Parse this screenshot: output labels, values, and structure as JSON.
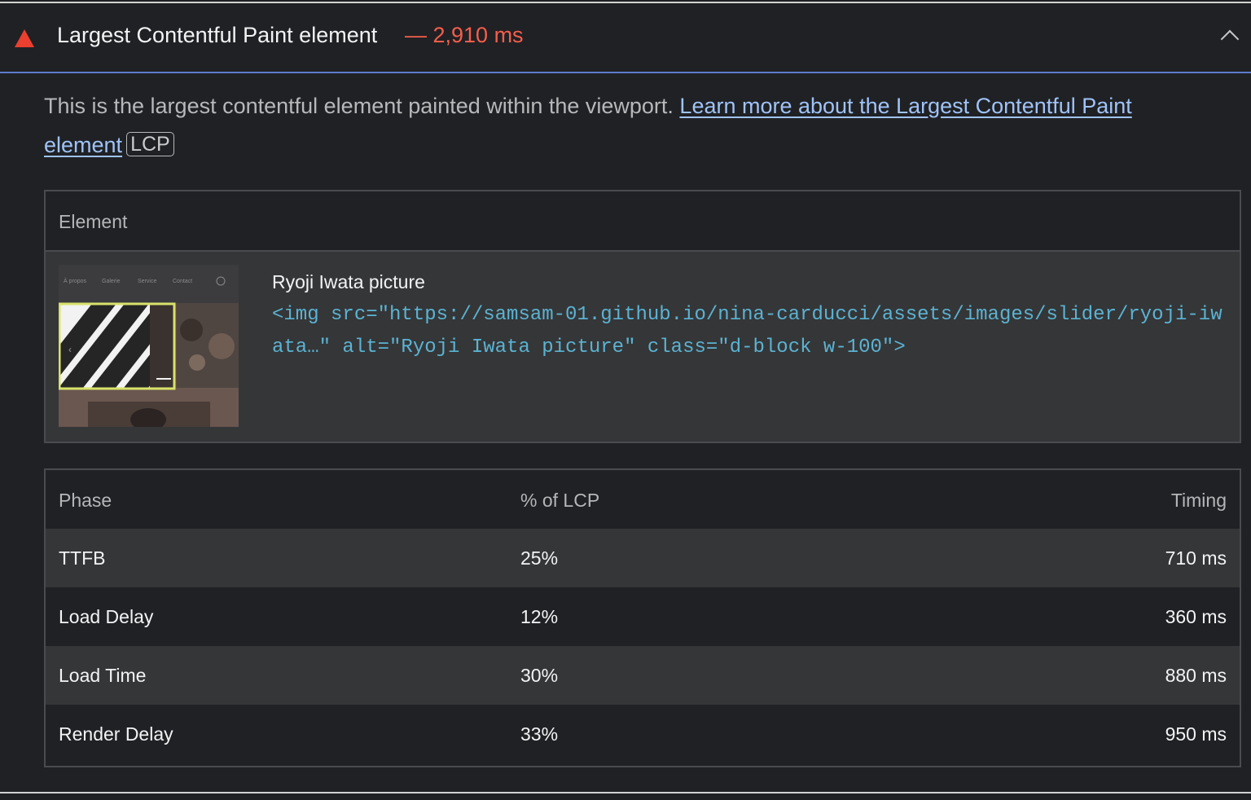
{
  "audit": {
    "title": "Largest Contentful Paint element",
    "value": "— 2,910 ms",
    "description_text": "This is the largest contentful element painted within the viewport. ",
    "learn_more_link": "Learn more about the Largest Contentful Paint element",
    "badge": "LCP"
  },
  "element_table": {
    "header": "Element",
    "node_label": "Ryoji Iwata picture",
    "node_snippet": "<img src=\"https://samsam-01.github.io/nina-carducci/assets/images/slider/ryoji-iwata…\" alt=\"Ryoji Iwata picture\" class=\"d-block w-100\">",
    "thumbnail_nav": [
      "À propos",
      "Galerie",
      "Service",
      "Contact"
    ]
  },
  "phase_table": {
    "headers": {
      "phase": "Phase",
      "percent": "% of LCP",
      "timing": "Timing"
    },
    "rows": [
      {
        "phase": "TTFB",
        "percent": "25%",
        "timing": "710 ms"
      },
      {
        "phase": "Load Delay",
        "percent": "12%",
        "timing": "360 ms"
      },
      {
        "phase": "Load Time",
        "percent": "30%",
        "timing": "880 ms"
      },
      {
        "phase": "Render Delay",
        "percent": "33%",
        "timing": "950 ms"
      }
    ]
  },
  "colors": {
    "background": "#202124",
    "warning": "#eb3f2f",
    "fail_value": "#f55e4c",
    "link": "#9fc3f8",
    "code": "#5bb3d2",
    "accent_border": "#5e7ccd"
  }
}
